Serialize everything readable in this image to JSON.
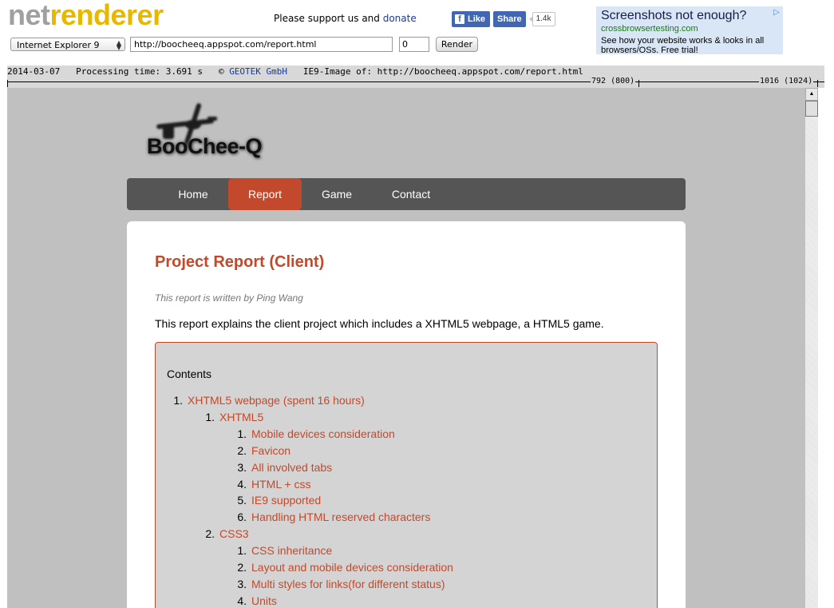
{
  "header": {
    "logo_part1": "net",
    "logo_part2": "renderer",
    "support_text": "Please support us and",
    "donate_link": "donate",
    "fb_like": "Like",
    "fb_share": "Share",
    "fb_count": "1.4k",
    "ad": {
      "title": "Screenshots not enough?",
      "url": "crossbrowsertesting.com",
      "text": "See how your website works & looks in all browsers/OSs. Free trial!"
    },
    "browser_select": "Internet Explorer 9",
    "url_value": "http://boocheeq.appspot.com/report.html",
    "number_value": "0",
    "render_button": "Render"
  },
  "infobar": {
    "date": "2014-03-07",
    "processing": "Processing time: 3.691 s",
    "copyright": "©",
    "company": "GEOTEK GmbH",
    "image_of": "IE9-Image of: http://boocheeq.appspot.com/report.html",
    "ruler_mark_1": "792 (800)",
    "ruler_mark_2": "1016 (1024)"
  },
  "site": {
    "brand": "BooChee-Q",
    "nav": [
      "Home",
      "Report",
      "Game",
      "Contact"
    ],
    "active_nav": "Report",
    "title": "Project Report (Client)",
    "byline": "This report is written by Ping Wang",
    "intro": "This report explains the client project which includes a XHTML5 webpage, a HTML5 game.",
    "toc_heading": "Contents",
    "toc": [
      {
        "num": "1.",
        "text": "XHTML5 webpage (spent 16 hours)",
        "level": 1
      },
      {
        "num": "1.",
        "text": "XHTML5",
        "level": 2
      },
      {
        "num": "1.",
        "text": "Mobile devices consideration",
        "level": 3
      },
      {
        "num": "2.",
        "text": "Favicon",
        "level": 3
      },
      {
        "num": "3.",
        "text": "All involved tabs",
        "level": 3
      },
      {
        "num": "4.",
        "text": "HTML + css",
        "level": 3
      },
      {
        "num": "5.",
        "text": "IE9 supported",
        "level": 3
      },
      {
        "num": "6.",
        "text": "Handling HTML reserved characters",
        "level": 3
      },
      {
        "num": "2.",
        "text": "CSS3",
        "level": 2
      },
      {
        "num": "1.",
        "text": "CSS inheritance",
        "level": 3
      },
      {
        "num": "2.",
        "text": "Layout and mobile devices consideration",
        "level": 3
      },
      {
        "num": "3.",
        "text": "Multi styles for links(for different status)",
        "level": 3
      },
      {
        "num": "4.",
        "text": "Units",
        "level": 3
      }
    ]
  },
  "colors": {
    "accent": "#c2492b",
    "nav_bg": "#555555",
    "page_bg": "#c0c0c0",
    "logo_gray": "#a0a0a0",
    "logo_yellow": "#e8b800"
  }
}
